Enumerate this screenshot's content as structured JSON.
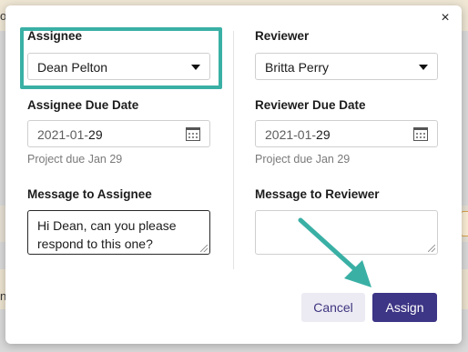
{
  "background": {
    "top_text": "op",
    "low_text": "n"
  },
  "dialog": {
    "close_symbol": "×",
    "assignee": {
      "label": "Assignee",
      "selected": "Dean Pelton",
      "due_label": "Assignee Due Date",
      "due_year_month": "2021-01-",
      "due_day": "29",
      "due_hint": "Project due Jan 29",
      "message_label": "Message to Assignee",
      "message_value": "Hi Dean, can you please respond to this one?"
    },
    "reviewer": {
      "label": "Reviewer",
      "selected": "Britta Perry",
      "due_label": "Reviewer Due Date",
      "due_year_month": "2021-01-",
      "due_day": "29",
      "due_hint": "Project due Jan 29",
      "message_label": "Message to Reviewer",
      "message_value": ""
    },
    "buttons": {
      "cancel": "Cancel",
      "assign": "Assign"
    }
  },
  "colors": {
    "highlight": "#3ab0a5",
    "primary": "#3d3585",
    "secondary_bg": "#ecebf3"
  },
  "icons": [
    "close-icon",
    "chevron-down-icon",
    "calendar-icon",
    "resize-grip-icon",
    "annotation-arrow-icon"
  ]
}
